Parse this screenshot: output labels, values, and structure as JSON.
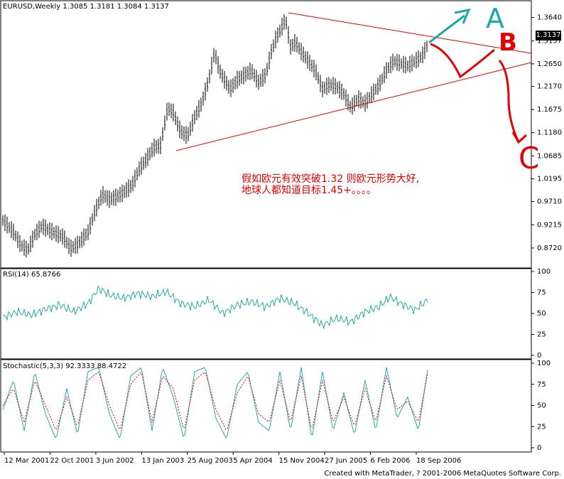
{
  "chart_data": [
    {
      "type": "candlestick",
      "title": "EURUSD,Weekly",
      "ohlc_text": "1.3085 1.3181 1.3084 1.3137",
      "last_value": "1.3137",
      "yticks": [
        "1.3640",
        "1.3137",
        "1.2650",
        "1.2170",
        "1.1675",
        "1.1180",
        "1.0685",
        "1.0195",
        "0.9710",
        "0.9215",
        "0.8720"
      ],
      "ylim": [
        0.84,
        1.38
      ],
      "xticks": [
        "12 Mar 2001",
        "22 Oct 2001",
        "3 Jun 2002",
        "13 Jan 2003",
        "25 Aug 2003",
        "5 Apr 2004",
        "15 Nov 2004",
        "27 Jun 2005",
        "6 Feb 2006",
        "18 Sep 2006"
      ],
      "series": [
        {
          "values": [
            [
              0,
              0.93
            ],
            [
              15,
              0.905
            ],
            [
              25,
              0.878
            ],
            [
              35,
              0.866
            ],
            [
              45,
              0.9
            ],
            [
              55,
              0.918
            ],
            [
              70,
              0.905
            ],
            [
              85,
              0.895
            ],
            [
              95,
              0.87
            ],
            [
              105,
              0.878
            ],
            [
              120,
              0.905
            ],
            [
              130,
              0.95
            ],
            [
              140,
              0.985
            ],
            [
              150,
              0.975
            ],
            [
              160,
              0.98
            ],
            [
              170,
              0.99
            ],
            [
              182,
              1.005
            ],
            [
              192,
              1.04
            ],
            [
              202,
              1.06
            ],
            [
              212,
              1.085
            ],
            [
              222,
              1.09
            ],
            [
              232,
              1.17
            ],
            [
              240,
              1.16
            ],
            [
              250,
              1.12
            ],
            [
              260,
              1.11
            ],
            [
              270,
              1.15
            ],
            [
              280,
              1.18
            ],
            [
              290,
              1.23
            ],
            [
              298,
              1.29
            ],
            [
              305,
              1.25
            ],
            [
              312,
              1.23
            ],
            [
              320,
              1.21
            ],
            [
              330,
              1.23
            ],
            [
              340,
              1.24
            ],
            [
              350,
              1.25
            ],
            [
              360,
              1.225
            ],
            [
              370,
              1.24
            ],
            [
              378,
              1.29
            ],
            [
              385,
              1.32
            ],
            [
              392,
              1.34
            ],
            [
              398,
              1.36
            ],
            [
              405,
              1.3
            ],
            [
              412,
              1.31
            ],
            [
              420,
              1.29
            ],
            [
              430,
              1.27
            ],
            [
              440,
              1.25
            ],
            [
              450,
              1.21
            ],
            [
              460,
              1.22
            ],
            [
              470,
              1.215
            ],
            [
              480,
              1.2
            ],
            [
              490,
              1.17
            ],
            [
              500,
              1.19
            ],
            [
              510,
              1.18
            ],
            [
              520,
              1.2
            ],
            [
              530,
              1.22
            ],
            [
              540,
              1.25
            ],
            [
              550,
              1.27
            ],
            [
              560,
              1.265
            ],
            [
              570,
              1.26
            ],
            [
              580,
              1.27
            ],
            [
              590,
              1.28
            ],
            [
              598,
              1.305
            ]
          ]
        }
      ]
    },
    {
      "type": "line",
      "title": "RSI(14) 65.8766",
      "yticks": [
        "100",
        "75",
        "50",
        "25",
        "0"
      ],
      "ylim": [
        0,
        100
      ],
      "series": [
        {
          "values": [
            [
              0,
              45
            ],
            [
              20,
              52
            ],
            [
              40,
              48
            ],
            [
              60,
              55
            ],
            [
              80,
              60
            ],
            [
              100,
              52
            ],
            [
              120,
              62
            ],
            [
              135,
              80
            ],
            [
              150,
              72
            ],
            [
              170,
              68
            ],
            [
              190,
              74
            ],
            [
              210,
              70
            ],
            [
              230,
              76
            ],
            [
              250,
              62
            ],
            [
              270,
              58
            ],
            [
              290,
              66
            ],
            [
              310,
              50
            ],
            [
              330,
              60
            ],
            [
              350,
              64
            ],
            [
              370,
              58
            ],
            [
              390,
              68
            ],
            [
              410,
              62
            ],
            [
              430,
              50
            ],
            [
              450,
              36
            ],
            [
              470,
              44
            ],
            [
              490,
              40
            ],
            [
              510,
              52
            ],
            [
              530,
              58
            ],
            [
              545,
              70
            ],
            [
              560,
              62
            ],
            [
              580,
              54
            ],
            [
              598,
              66
            ]
          ]
        }
      ]
    },
    {
      "type": "line",
      "title": "Stochastic(5,3,3)",
      "legend_values": "92.3333 88.4722",
      "yticks": [
        "100",
        "75",
        "50",
        "25",
        "0"
      ],
      "ylim": [
        0,
        100
      ],
      "series": [
        {
          "values": [
            [
              0,
              45
            ],
            [
              15,
              80
            ],
            [
              30,
              20
            ],
            [
              45,
              90
            ],
            [
              60,
              40
            ],
            [
              75,
              10
            ],
            [
              90,
              70
            ],
            [
              105,
              15
            ],
            [
              120,
              90
            ],
            [
              135,
              95
            ],
            [
              150,
              40
            ],
            [
              165,
              10
            ],
            [
              180,
              85
            ],
            [
              195,
              95
            ],
            [
              210,
              20
            ],
            [
              225,
              95
            ],
            [
              240,
              60
            ],
            [
              255,
              10
            ],
            [
              270,
              90
            ],
            [
              285,
              95
            ],
            [
              300,
              35
            ],
            [
              315,
              10
            ],
            [
              330,
              75
            ],
            [
              345,
              90
            ],
            [
              360,
              30
            ],
            [
              375,
              20
            ],
            [
              390,
              90
            ],
            [
              405,
              20
            ],
            [
              420,
              95
            ],
            [
              435,
              10
            ],
            [
              450,
              90
            ],
            [
              465,
              20
            ],
            [
              480,
              65
            ],
            [
              495,
              15
            ],
            [
              510,
              80
            ],
            [
              525,
              20
            ],
            [
              540,
              95
            ],
            [
              555,
              35
            ],
            [
              570,
              60
            ],
            [
              585,
              20
            ],
            [
              598,
              92
            ]
          ]
        },
        {
          "values": [
            [
              0,
              50
            ],
            [
              15,
              70
            ],
            [
              30,
              30
            ],
            [
              45,
              80
            ],
            [
              60,
              50
            ],
            [
              75,
              20
            ],
            [
              90,
              60
            ],
            [
              105,
              25
            ],
            [
              120,
              80
            ],
            [
              135,
              90
            ],
            [
              150,
              50
            ],
            [
              165,
              20
            ],
            [
              180,
              75
            ],
            [
              195,
              90
            ],
            [
              210,
              30
            ],
            [
              225,
              85
            ],
            [
              240,
              70
            ],
            [
              255,
              20
            ],
            [
              270,
              80
            ],
            [
              285,
              90
            ],
            [
              300,
              45
            ],
            [
              315,
              20
            ],
            [
              330,
              65
            ],
            [
              345,
              85
            ],
            [
              360,
              40
            ],
            [
              375,
              30
            ],
            [
              390,
              80
            ],
            [
              405,
              30
            ],
            [
              420,
              85
            ],
            [
              435,
              20
            ],
            [
              450,
              80
            ],
            [
              465,
              30
            ],
            [
              480,
              60
            ],
            [
              495,
              25
            ],
            [
              510,
              70
            ],
            [
              525,
              30
            ],
            [
              540,
              85
            ],
            [
              555,
              45
            ],
            [
              570,
              55
            ],
            [
              585,
              30
            ],
            [
              598,
              88
            ]
          ]
        }
      ]
    }
  ],
  "annotation": {
    "line1": "假如欧元有效突破1.32 则欧元形势大好,",
    "line2": "地球人都知道目标1.45+。。。。"
  },
  "markers": {
    "a": "A",
    "b": "B",
    "c": "C"
  },
  "footer": "Created with MetaTrader, ? 2001-2006 MetaQuotes Software Corp.",
  "colors": {
    "candle": "#000000",
    "rsi": "#2aa6a6",
    "stoch_main": "#2aa6a6",
    "stoch_signal": "#e00000",
    "trend": "#e00000",
    "arrow_teal": "#21a6a6",
    "arrow_red": "#e00000",
    "last_box": "#000000"
  }
}
